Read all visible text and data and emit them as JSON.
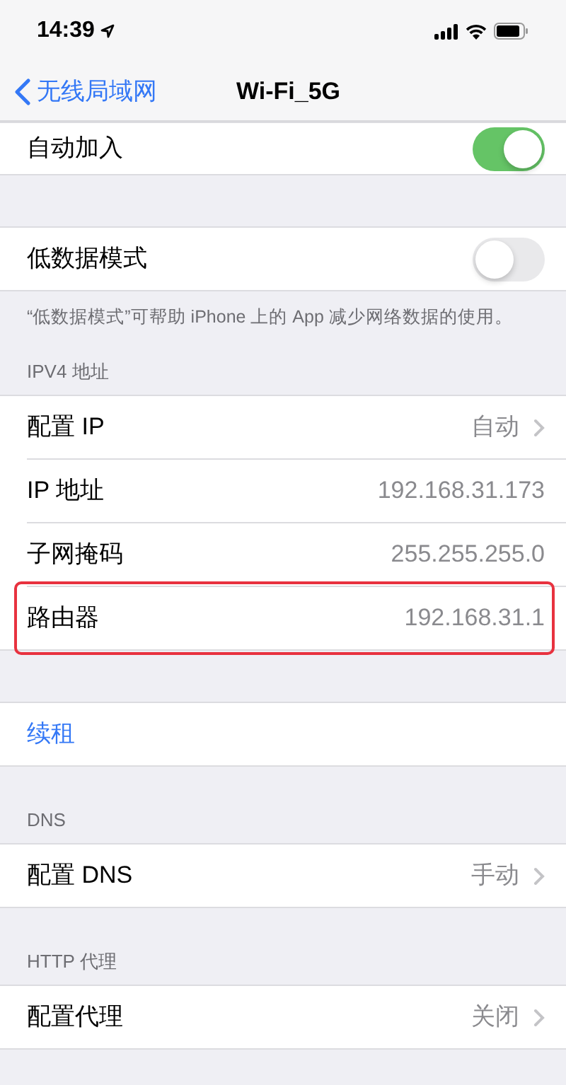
{
  "status_bar": {
    "time": "14:39"
  },
  "nav": {
    "back": "无线局域网",
    "title": "Wi-Fi_5G"
  },
  "sections": [
    {
      "rows": [
        {
          "kind": "toggle",
          "label": "自动加入",
          "on": true
        }
      ]
    },
    {
      "rows": [
        {
          "kind": "toggle",
          "label": "低数据模式",
          "on": false
        }
      ],
      "footer": "“低数据模式”可帮助 iPhone 上的 App 减少网络数据的使用。"
    },
    {
      "header": "IPV4 地址",
      "rows": [
        {
          "kind": "link",
          "label": "配置 IP",
          "value": "自动",
          "highlighted": false
        },
        {
          "kind": "value",
          "label": "IP 地址",
          "value": "192.168.31.173",
          "highlighted": false
        },
        {
          "kind": "value",
          "label": "子网掩码",
          "value": "255.255.255.0",
          "highlighted": false
        },
        {
          "kind": "value",
          "label": "路由器",
          "value": "192.168.31.1",
          "highlighted": true
        }
      ]
    },
    {
      "rows": [
        {
          "kind": "action",
          "label": "续租"
        }
      ]
    },
    {
      "header": "DNS",
      "rows": [
        {
          "kind": "link",
          "label": "配置 DNS",
          "value": "手动",
          "highlighted": false
        }
      ]
    },
    {
      "header": "HTTP 代理",
      "rows": [
        {
          "kind": "link",
          "label": "配置代理",
          "value": "关闭",
          "highlighted": false
        }
      ]
    }
  ]
}
